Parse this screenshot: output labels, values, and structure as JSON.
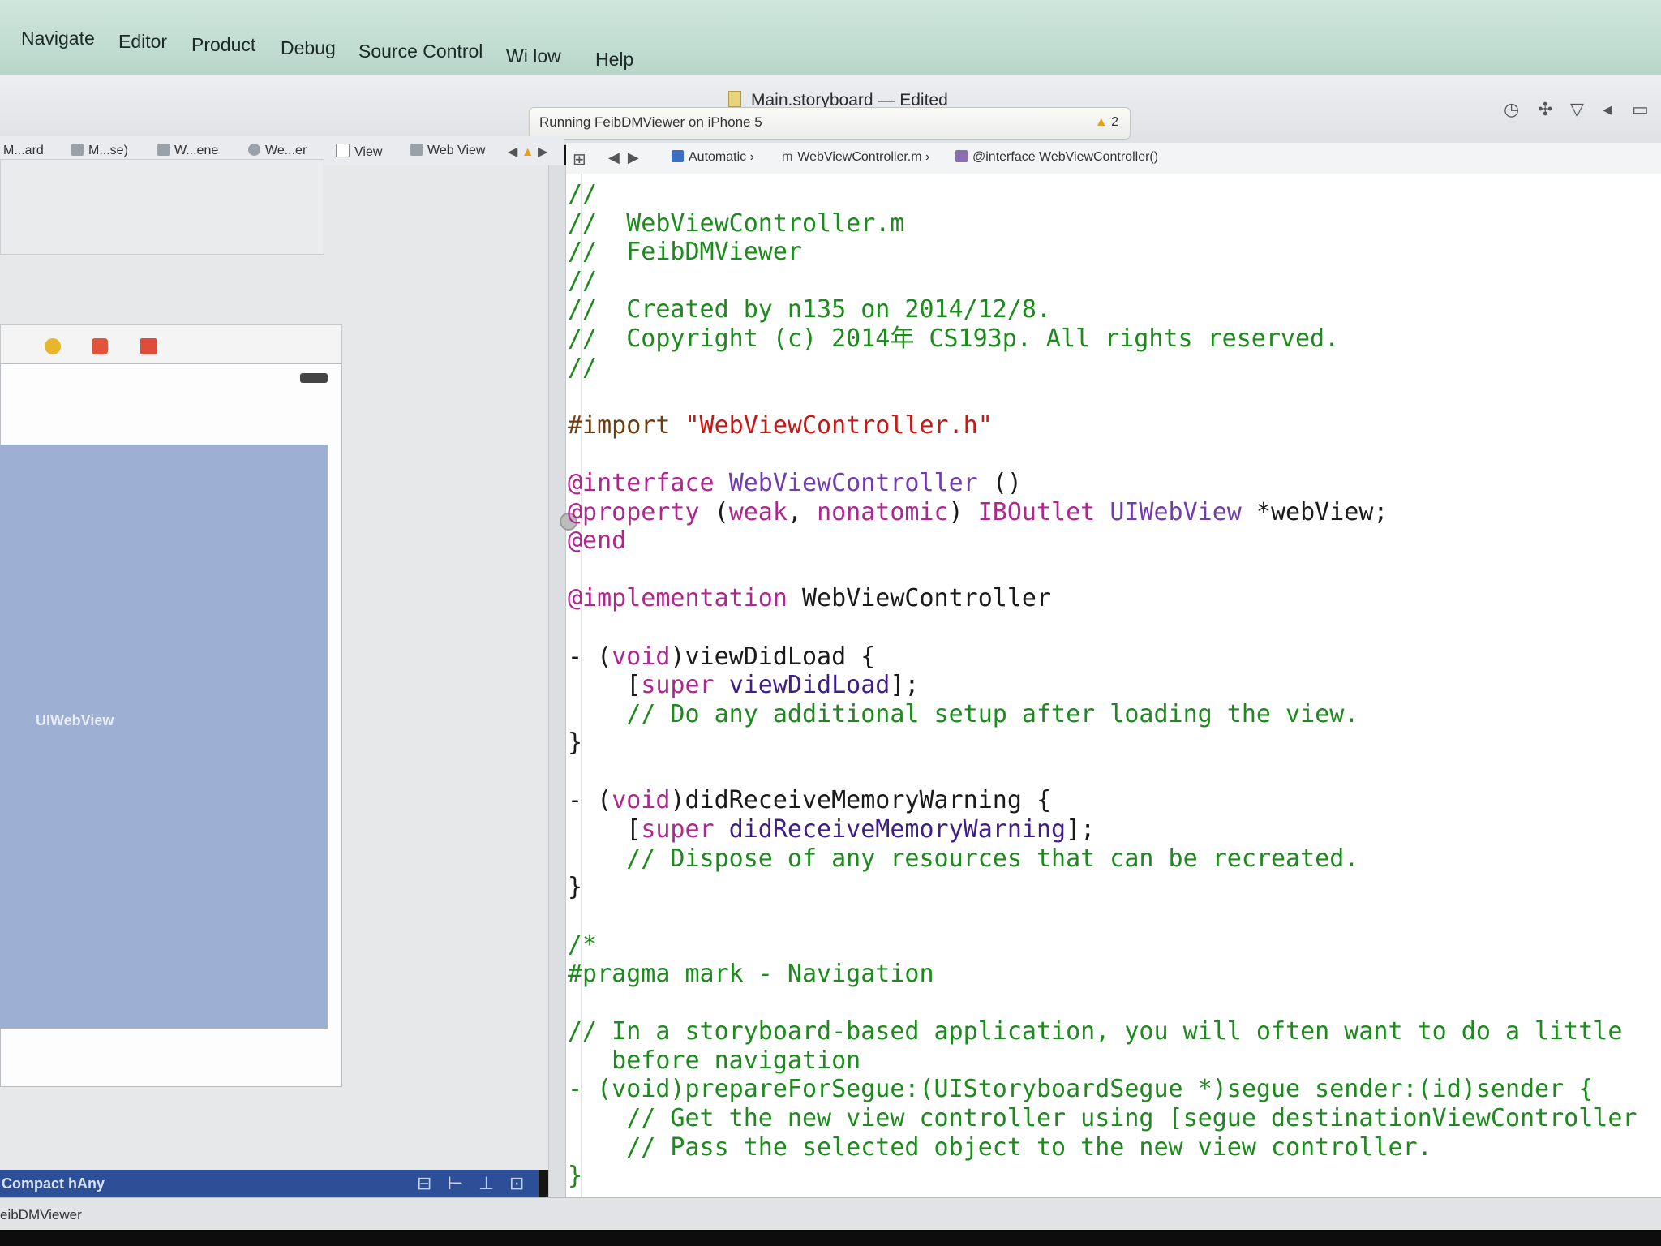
{
  "menu": [
    "Navigate",
    "Editor",
    "Product",
    "Debug",
    "Source Control",
    "Wi  low",
    "Help"
  ],
  "window_title": "Main.storyboard — Edited",
  "activity": {
    "status": "Running FeibDMViewer on iPhone 5",
    "warning_count": "2"
  },
  "left_jump_bar": [
    "M...ard",
    "M...se)",
    "W...ene",
    "We...er",
    "View",
    "Web View"
  ],
  "right_jump_bar": [
    "Automatic",
    "WebViewController.m",
    "@interface WebViewController()"
  ],
  "canvas": {
    "webview_label": "UIWebView"
  },
  "size_class": {
    "width": "Compact",
    "height": "hAny"
  },
  "status_text": "eibDMViewer",
  "code_lines": [
    [
      {
        "t": "//",
        "c": "comment"
      }
    ],
    [
      {
        "t": "//  WebViewController.m",
        "c": "comment"
      }
    ],
    [
      {
        "t": "//  FeibDMViewer",
        "c": "comment"
      }
    ],
    [
      {
        "t": "//",
        "c": "comment"
      }
    ],
    [
      {
        "t": "//  Created by n135 on 2014/12/8.",
        "c": "comment"
      }
    ],
    [
      {
        "t": "//  Copyright (c) 2014年 CS193p. All rights reserved.",
        "c": "comment"
      }
    ],
    [
      {
        "t": "//",
        "c": "comment"
      }
    ],
    [],
    [
      {
        "t": "#import ",
        "c": "preproc"
      },
      {
        "t": "\"WebViewController.h\"",
        "c": "string"
      }
    ],
    [],
    [
      {
        "t": "@interface ",
        "c": "keyword"
      },
      {
        "t": "WebViewController",
        "c": "type"
      },
      {
        "t": " ()",
        "c": "plain"
      }
    ],
    [
      {
        "t": "@property ",
        "c": "keyword"
      },
      {
        "t": "(",
        "c": "plain"
      },
      {
        "t": "weak",
        "c": "keyword"
      },
      {
        "t": ", ",
        "c": "plain"
      },
      {
        "t": "nonatomic",
        "c": "keyword"
      },
      {
        "t": ") ",
        "c": "plain"
      },
      {
        "t": "IBOutlet ",
        "c": "keyword"
      },
      {
        "t": "UIWebView",
        "c": "type"
      },
      {
        "t": " *webView;",
        "c": "plain"
      }
    ],
    [
      {
        "t": "@end",
        "c": "keyword"
      }
    ],
    [],
    [
      {
        "t": "@implementation ",
        "c": "keyword"
      },
      {
        "t": "WebViewController",
        "c": "plain"
      }
    ],
    [],
    [
      {
        "t": "- (",
        "c": "plain"
      },
      {
        "t": "void",
        "c": "keyword"
      },
      {
        "t": ")viewDidLoad {",
        "c": "plain"
      }
    ],
    [
      {
        "t": "    [",
        "c": "plain"
      },
      {
        "t": "super",
        "c": "keyword"
      },
      {
        "t": " ",
        "c": "plain"
      },
      {
        "t": "viewDidLoad",
        "c": "member"
      },
      {
        "t": "];",
        "c": "plain"
      }
    ],
    [
      {
        "t": "    // Do any additional setup after loading the view.",
        "c": "comment"
      }
    ],
    [
      {
        "t": "}",
        "c": "plain"
      }
    ],
    [],
    [
      {
        "t": "- (",
        "c": "plain"
      },
      {
        "t": "void",
        "c": "keyword"
      },
      {
        "t": ")didReceiveMemoryWarning {",
        "c": "plain"
      }
    ],
    [
      {
        "t": "    [",
        "c": "plain"
      },
      {
        "t": "super",
        "c": "keyword"
      },
      {
        "t": " ",
        "c": "plain"
      },
      {
        "t": "didReceiveMemoryWarning",
        "c": "member"
      },
      {
        "t": "];",
        "c": "plain"
      }
    ],
    [
      {
        "t": "    // Dispose of any resources that can be recreated.",
        "c": "comment"
      }
    ],
    [
      {
        "t": "}",
        "c": "plain"
      }
    ],
    [],
    [
      {
        "t": "/*",
        "c": "comment"
      }
    ],
    [
      {
        "t": "#pragma mark - Navigation",
        "c": "comment"
      }
    ],
    [],
    [
      {
        "t": "// In a storyboard-based application, you will often want to do a little",
        "c": "comment"
      }
    ],
    [
      {
        "t": "   before navigation",
        "c": "comment"
      }
    ],
    [
      {
        "t": "- (void)prepareForSegue:(UIStoryboardSegue *)segue sender:(id)sender {",
        "c": "comment"
      }
    ],
    [
      {
        "t": "    // Get the new view controller using [segue destinationViewController",
        "c": "comment"
      }
    ],
    [
      {
        "t": "    // Pass the selected object to the new view controller.",
        "c": "comment"
      }
    ],
    [
      {
        "t": "}",
        "c": "comment"
      }
    ]
  ]
}
